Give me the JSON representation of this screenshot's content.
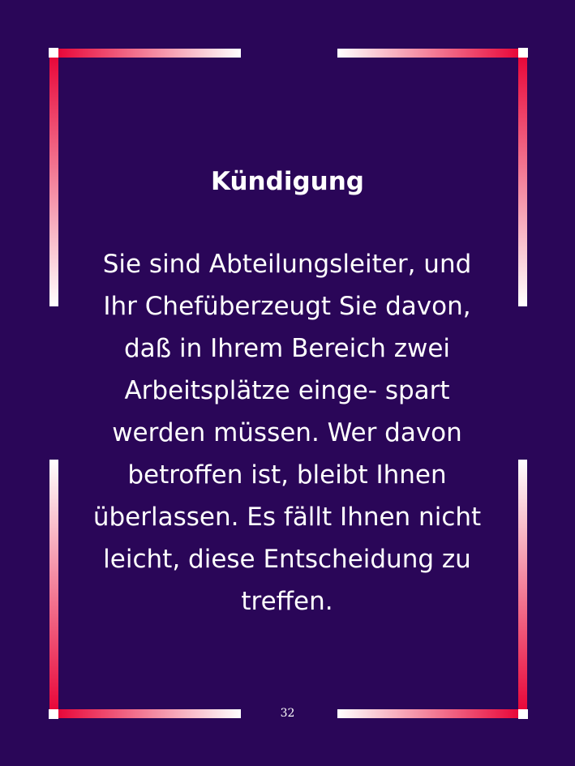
{
  "card": {
    "title": "Kündigung",
    "text": "Sie sind Abteilungsleiter, und Ihr Chefüberzeugt Sie davon, daß in Ihrem Bereich zwei Arbeitsplätze einge- spart werden müssen. Wer davon betroffen ist, bleibt Ihnen überlassen. Es fällt Ihnen nicht leicht, diese Entscheidung zu treffen.",
    "page_number": "32"
  },
  "colors": {
    "background": "#2a0658",
    "frame_accent": "#e8083a",
    "frame_light": "#ffffff",
    "text": "#ffffff"
  }
}
